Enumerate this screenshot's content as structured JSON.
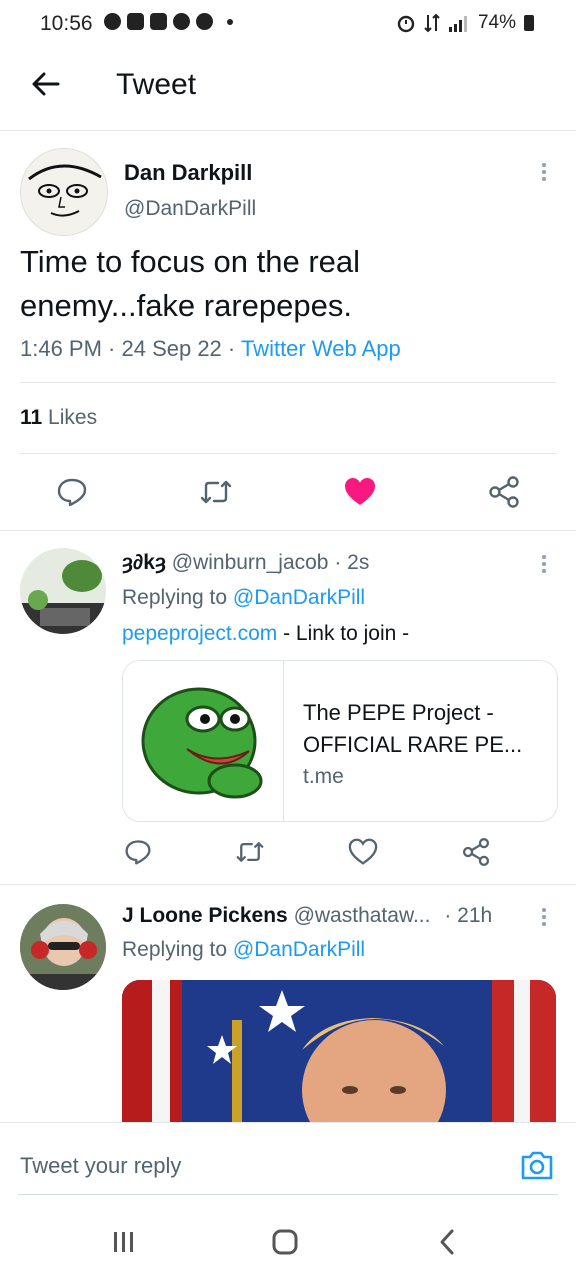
{
  "status_bar": {
    "time": "10:56",
    "battery": "74%"
  },
  "header": {
    "title": "Tweet"
  },
  "main_tweet": {
    "name": "Dan Darkpill",
    "handle": "@DanDarkPill",
    "text_line1": "Time to focus on the real",
    "text_line2": "enemy...fake rarepepes.",
    "timestamp": "1:46 PM · 24 Sep 22 · ",
    "source": "Twitter Web App",
    "likes_count": "11",
    "likes_label": "Likes"
  },
  "replies": [
    {
      "name": "ȝ∂kȝ",
      "handle": "@winburn_jacob",
      "age": "· 2s",
      "replying_prefix": "Replying to ",
      "replying_to": "@DanDarkPill",
      "link_text": "pepeproject.com",
      "text_rest": " - Link to join -",
      "card": {
        "title_line1": "The PEPE Project -",
        "title_line2": "OFFICIAL RARE PE...",
        "domain": "t.me"
      }
    },
    {
      "name": "J Loone Pickens",
      "handle": "@wasthataw...",
      "age": "· 21h",
      "replying_prefix": "Replying to ",
      "replying_to": "@DanDarkPill"
    }
  ],
  "reply_bar": {
    "placeholder": "Tweet your reply"
  },
  "colors": {
    "accent": "#1d9bf0",
    "like": "#f91880",
    "text": "#0f1419",
    "muted": "#536471"
  }
}
